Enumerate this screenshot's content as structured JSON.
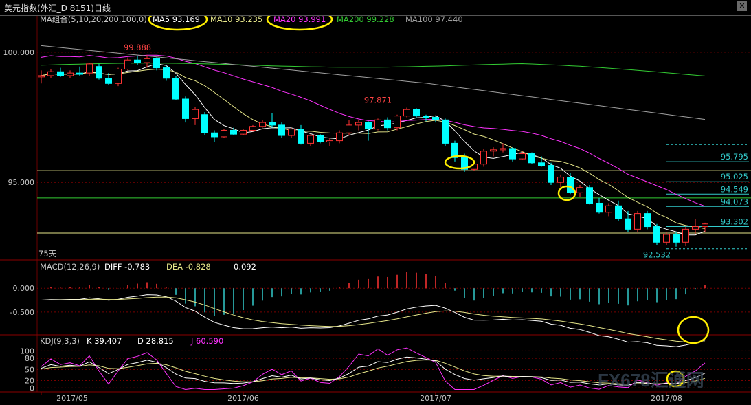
{
  "window": {
    "title": "美元指数(外汇_D 8151)日线"
  },
  "chart_data": [
    {
      "type": "candlestick",
      "title": "MA组合(5,10,20,200,100,0)",
      "ma_legend": [
        {
          "name": "MA5",
          "value": "93.169",
          "color": "#ffffff"
        },
        {
          "name": "MA10",
          "value": "93.235",
          "color": "#e6e68a"
        },
        {
          "name": "MA20",
          "value": "93.991",
          "color": "#ff33ff"
        },
        {
          "name": "MA200",
          "value": "99.228",
          "color": "#33cc33"
        },
        {
          "name": "MA100",
          "value": "97.440",
          "color": "#a0a0a0"
        }
      ],
      "ylim": [
        92.1,
        101.0
      ],
      "y_ticks": [
        "100.000",
        "95.000"
      ],
      "x_ticks": [
        "2017/05",
        "2017/06",
        "2017/07",
        "2017/08"
      ],
      "x_tick_index": [
        0,
        21,
        41,
        65
      ],
      "period_label": "75天",
      "annotations": [
        {
          "text": "99.888",
          "index": 10,
          "value": 99.888,
          "color": "#ff4444"
        },
        {
          "text": "97.871",
          "index": 35,
          "value": 97.871,
          "color": "#ff4444"
        },
        {
          "text": "92.532",
          "index": 64,
          "value": 92.532,
          "color": "#33cccc"
        }
      ],
      "levels": [
        {
          "text": "95.795",
          "value": 95.795
        },
        {
          "text": "95.025",
          "value": 95.025
        },
        {
          "text": "94.549",
          "value": 94.549
        },
        {
          "text": "94.073",
          "value": 94.073
        },
        {
          "text": "93.302",
          "value": 93.302
        }
      ],
      "horizontal_lines": [
        {
          "value": 95.45,
          "color": "#e6e68a"
        },
        {
          "value": 94.4,
          "color": "#33cc33"
        },
        {
          "value": 93.05,
          "color": "#e6e68a"
        }
      ],
      "candles": [
        [
          99.05,
          99.3,
          98.8,
          99.1
        ],
        [
          99.1,
          99.35,
          99.0,
          99.25
        ],
        [
          99.25,
          99.4,
          99.05,
          99.1
        ],
        [
          99.1,
          99.3,
          99.0,
          99.2
        ],
        [
          99.2,
          99.45,
          99.1,
          99.15
        ],
        [
          99.2,
          99.6,
          99.1,
          99.55
        ],
        [
          99.45,
          99.55,
          98.95,
          99.0
        ],
        [
          99.0,
          99.2,
          98.75,
          98.8
        ],
        [
          98.8,
          99.4,
          98.7,
          99.35
        ],
        [
          99.35,
          99.8,
          99.3,
          99.7
        ],
        [
          99.7,
          99.85,
          99.5,
          99.6
        ],
        [
          99.6,
          99.89,
          99.4,
          99.75
        ],
        [
          99.75,
          99.8,
          99.3,
          99.4
        ],
        [
          99.4,
          99.5,
          98.9,
          99.0
        ],
        [
          99.0,
          99.1,
          98.15,
          98.2
        ],
        [
          98.2,
          98.3,
          97.3,
          97.45
        ],
        [
          97.45,
          97.9,
          97.2,
          97.8
        ],
        [
          97.6,
          97.7,
          96.8,
          96.9
        ],
        [
          96.9,
          97.0,
          96.55,
          96.75
        ],
        [
          96.75,
          97.05,
          96.7,
          97.0
        ],
        [
          97.0,
          97.1,
          96.8,
          96.85
        ],
        [
          96.85,
          97.05,
          96.8,
          97.0
        ],
        [
          97.0,
          97.2,
          96.95,
          97.15
        ],
        [
          97.15,
          97.4,
          97.1,
          97.3
        ],
        [
          97.3,
          97.65,
          97.1,
          97.2
        ],
        [
          97.2,
          97.3,
          96.7,
          96.8
        ],
        [
          96.8,
          97.1,
          96.7,
          97.05
        ],
        [
          97.05,
          97.2,
          96.45,
          96.5
        ],
        [
          96.5,
          96.85,
          96.4,
          96.8
        ],
        [
          96.8,
          96.85,
          96.5,
          96.55
        ],
        [
          96.55,
          96.7,
          96.4,
          96.6
        ],
        [
          96.6,
          97.0,
          96.5,
          96.9
        ],
        [
          96.9,
          97.4,
          96.8,
          97.2
        ],
        [
          97.2,
          97.4,
          97.0,
          97.3
        ],
        [
          97.3,
          97.35,
          96.6,
          97.05
        ],
        [
          97.05,
          97.45,
          97.0,
          97.4
        ],
        [
          97.4,
          97.5,
          97.0,
          97.1
        ],
        [
          97.1,
          97.6,
          97.0,
          97.55
        ],
        [
          97.55,
          97.87,
          97.5,
          97.8
        ],
        [
          97.8,
          97.85,
          97.5,
          97.55
        ],
        [
          97.55,
          97.6,
          97.35,
          97.5
        ],
        [
          97.5,
          97.55,
          97.3,
          97.4
        ],
        [
          97.4,
          97.45,
          96.4,
          96.5
        ],
        [
          96.5,
          96.6,
          95.8,
          95.95
        ],
        [
          95.95,
          96.1,
          95.4,
          95.5
        ],
        [
          95.5,
          95.8,
          95.45,
          95.7
        ],
        [
          95.7,
          96.3,
          95.6,
          96.2
        ],
        [
          96.2,
          96.35,
          96.0,
          96.25
        ],
        [
          96.25,
          96.5,
          96.15,
          96.3
        ],
        [
          96.3,
          96.35,
          95.8,
          95.9
        ],
        [
          95.9,
          96.2,
          95.85,
          96.1
        ],
        [
          96.1,
          96.15,
          95.7,
          95.75
        ],
        [
          95.75,
          96.0,
          95.6,
          95.65
        ],
        [
          95.65,
          95.75,
          94.9,
          95.0
        ],
        [
          95.0,
          95.3,
          94.8,
          95.2
        ],
        [
          95.2,
          95.35,
          94.55,
          94.6
        ],
        [
          94.6,
          94.9,
          94.45,
          94.8
        ],
        [
          94.8,
          94.9,
          94.15,
          94.2
        ],
        [
          94.2,
          94.4,
          93.8,
          93.85
        ],
        [
          93.85,
          94.2,
          93.7,
          94.1
        ],
        [
          94.1,
          94.3,
          93.5,
          93.6
        ],
        [
          93.6,
          93.9,
          93.1,
          93.2
        ],
        [
          93.2,
          93.9,
          93.1,
          93.8
        ],
        [
          93.8,
          93.9,
          93.2,
          93.3
        ],
        [
          93.3,
          93.4,
          92.6,
          92.7
        ],
        [
          92.7,
          93.1,
          92.6,
          93.0
        ],
        [
          93.0,
          93.1,
          92.53,
          92.7
        ],
        [
          92.7,
          93.3,
          92.55,
          93.2
        ],
        [
          93.2,
          93.6,
          93.0,
          93.3
        ],
        [
          93.3,
          93.45,
          93.1,
          93.4
        ]
      ]
    },
    {
      "type": "line",
      "title": "MACD(12,26,9)",
      "legend": [
        {
          "name": "DIFF",
          "value": "-0.783",
          "color": "#ffffff"
        },
        {
          "name": "DEA",
          "value": "-0.828",
          "color": "#e6e68a"
        },
        {
          "name": "",
          "value": "0.092",
          "color": "#ffffff"
        }
      ],
      "ylim": [
        -0.95,
        0.35
      ],
      "y_ticks": [
        "0.000",
        "-0.500"
      ]
    },
    {
      "type": "line",
      "title": "KDJ(9,3,3)",
      "legend": [
        {
          "name": "K",
          "value": "39.407",
          "color": "#ffffff"
        },
        {
          "name": "D",
          "value": "28.815",
          "color": "#e6e68a"
        },
        {
          "name": "J",
          "value": "60.590",
          "color": "#ff33ff"
        }
      ],
      "ylim": [
        -5,
        110
      ],
      "y_ticks": [
        "100",
        "80",
        "50",
        "20",
        "0"
      ]
    }
  ],
  "watermark": "FX678汇通网"
}
